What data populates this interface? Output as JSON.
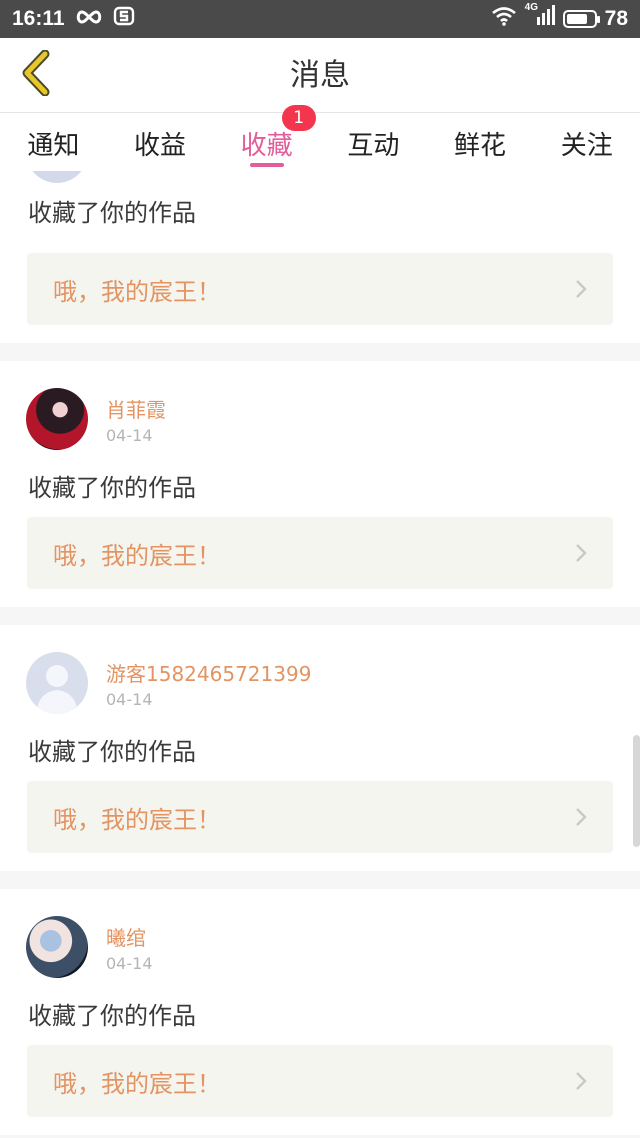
{
  "status_bar": {
    "time": "16:11",
    "network": "4G",
    "battery": "78",
    "battery_level": 0.78,
    "icons": [
      "infinity-icon",
      "s-app-icon",
      "wifi-icon",
      "signal-icon",
      "battery-icon"
    ]
  },
  "header": {
    "title": "消息",
    "back_icon": "chevron-left-icon",
    "accent_color": "#e8c72b"
  },
  "tabs": [
    {
      "label": "通知",
      "active": false
    },
    {
      "label": "收益",
      "active": false
    },
    {
      "label": "收藏",
      "active": true,
      "badge": "1"
    },
    {
      "label": "互动",
      "active": false
    },
    {
      "label": "鲜花",
      "active": false
    },
    {
      "label": "关注",
      "active": false
    }
  ],
  "colors": {
    "active_tab": "#e25d9a",
    "badge": "#f3364d",
    "username": "#e39462",
    "work_title": "#e39462"
  },
  "messages": [
    {
      "username": "",
      "date": "",
      "action": "收藏了你的作品",
      "work": "哦，我的宸王！",
      "avatar": "default-avatar-icon"
    },
    {
      "username": "肖菲霞",
      "date": "04-14",
      "action": "收藏了你的作品",
      "work": "哦，我的宸王！",
      "avatar": "user-photo-avatar"
    },
    {
      "username": "游客1582465721399",
      "date": "04-14",
      "action": "收藏了你的作品",
      "work": "哦，我的宸王！",
      "avatar": "default-avatar-icon"
    },
    {
      "username": "曦绾",
      "date": "04-14",
      "action": "收藏了你的作品",
      "work": "哦，我的宸王！",
      "avatar": "user-photo-avatar"
    }
  ]
}
